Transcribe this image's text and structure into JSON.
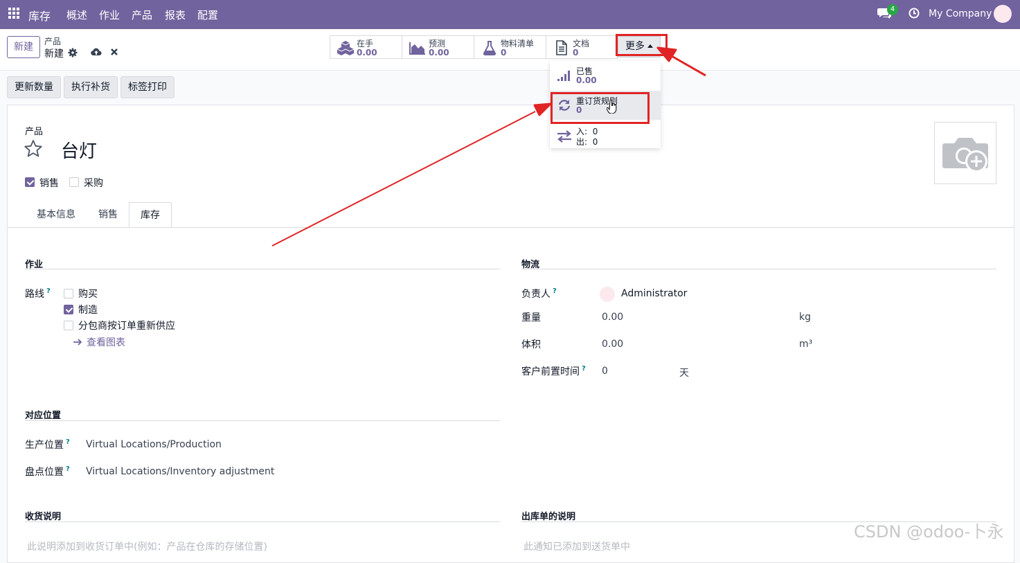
{
  "navbar": {
    "brand": "库存",
    "menu": [
      "概述",
      "作业",
      "产品",
      "报表",
      "配置"
    ],
    "messages_badge": "4",
    "company": "My Company"
  },
  "control": {
    "new_button": "新建",
    "breadcrumb_parent": "产品",
    "breadcrumb_current": "新建",
    "smart_buttons": [
      {
        "label": "在手",
        "value": "0.00",
        "icon": "cubes-icon"
      },
      {
        "label": "预测",
        "value": "0.00",
        "icon": "area-chart-icon"
      },
      {
        "label": "物料清单",
        "value": "0",
        "icon": "flask-icon"
      },
      {
        "label": "文档",
        "value": "0",
        "icon": "file-icon"
      }
    ],
    "more_button": "更多"
  },
  "dropdown": {
    "sold": {
      "label": "已售",
      "value": "0.00",
      "icon": "signal-icon"
    },
    "reorder": {
      "label": "重订货规则",
      "value": "0",
      "icon": "refresh-icon"
    },
    "in_label": "入:",
    "in_value": "0",
    "out_label": "出:",
    "out_value": "0",
    "moves_icon": "exchange-icon"
  },
  "actions": {
    "update_qty": "更新数量",
    "replenish": "执行补货",
    "print_labels": "标签打印"
  },
  "product": {
    "kind_label": "产品",
    "name": "台灯",
    "can_be_sold_label": "销售",
    "can_be_sold": true,
    "can_be_purchased_label": "采购",
    "can_be_purchased": false
  },
  "tabs": [
    "基本信息",
    "销售",
    "库存"
  ],
  "active_tab": "库存",
  "operations": {
    "title": "作业",
    "routes_label": "路线",
    "help_mark": "?",
    "routes": [
      {
        "label": "购买",
        "checked": false
      },
      {
        "label": "制造",
        "checked": true
      },
      {
        "label": "分包商按订单重新供应",
        "checked": false
      }
    ],
    "view_diagram": "查看图表"
  },
  "logistics": {
    "title": "物流",
    "responsible_label": "负责人",
    "responsible_value": "Administrator",
    "weight_label": "重量",
    "weight_value": "0.00",
    "weight_unit": "kg",
    "volume_label": "体积",
    "volume_value": "0.00",
    "volume_unit": "m³",
    "lead_time_label": "客户前置时间",
    "lead_time_value": "0",
    "lead_time_unit": "天"
  },
  "locations": {
    "title": "对应位置",
    "production_label": "生产位置",
    "production_value": "Virtual Locations/Production",
    "inventory_label": "盘点位置",
    "inventory_value": "Virtual Locations/Inventory adjustment"
  },
  "receipt_notes": {
    "title": "收货说明",
    "placeholder": "此说明添加到收货订单中(例如：产品在仓库的存储位置)"
  },
  "delivery_notes": {
    "title": "出库单的说明",
    "placeholder": "此通知已添加到送货单中"
  },
  "watermark": "CSDN @odoo-卜永",
  "colors": {
    "brand": "#71639e",
    "annotation": "#e02424",
    "help": "#017e84"
  }
}
